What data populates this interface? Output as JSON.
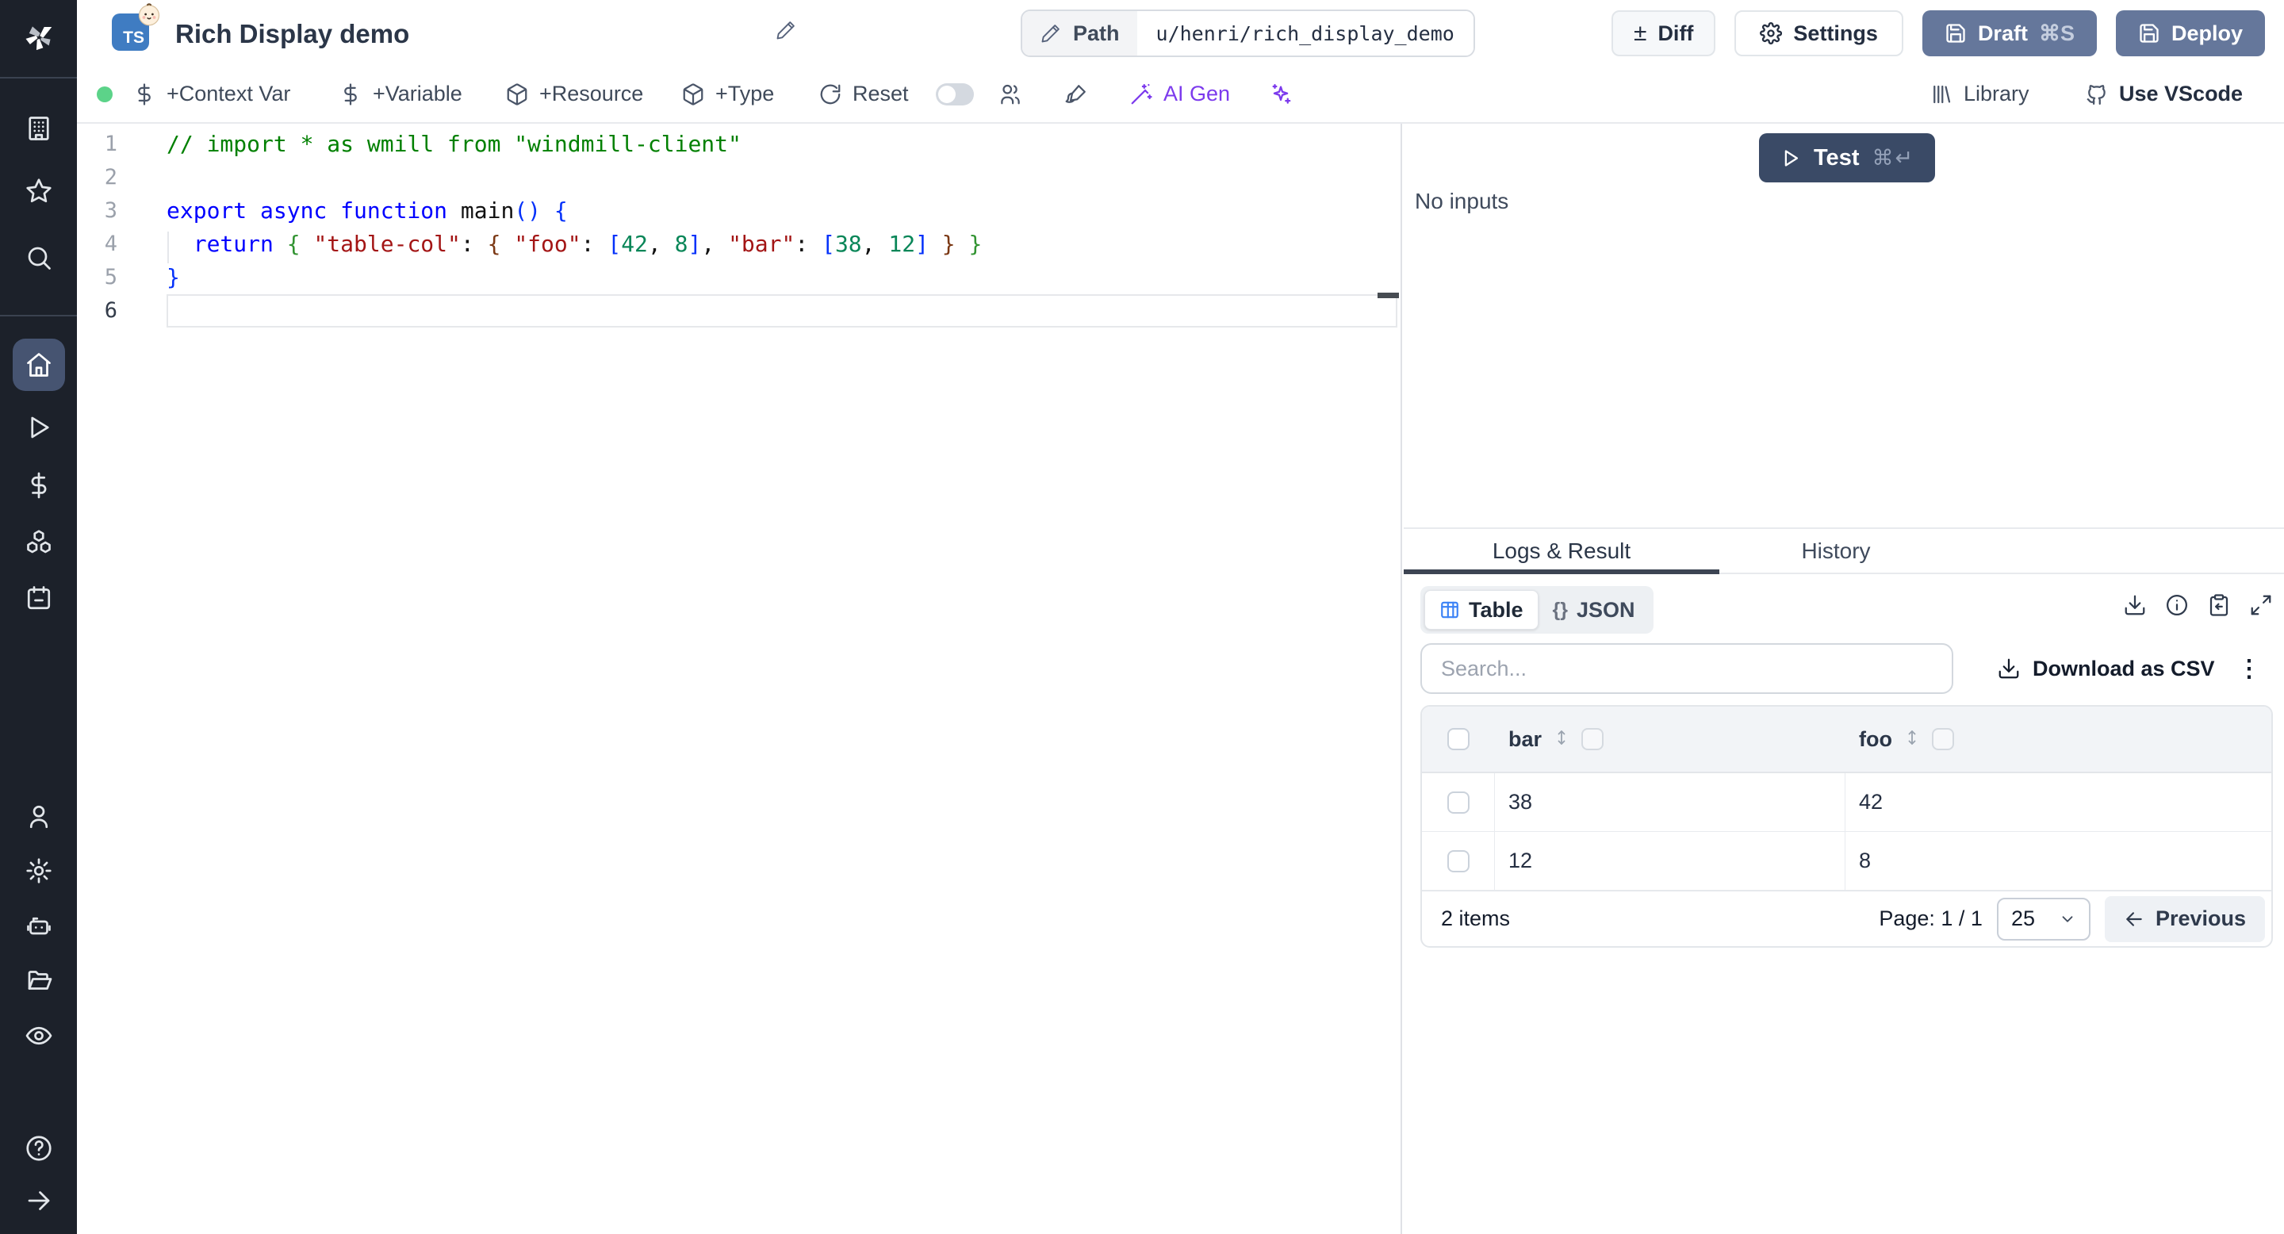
{
  "colors": {
    "sidebar_bg": "#1c212a",
    "sidebar_active_pill": "#465471",
    "status_green": "#5cd389",
    "ts_badge_blue": "#3f7cc2",
    "slate_button": "#65779b",
    "test_button": "#3a4a66",
    "ai_purple": "#7c3aed",
    "table_icon_blue": "#3b82f6",
    "code_comment": "#008000",
    "code_keyword": "#0000ff",
    "code_string": "#a31515",
    "code_number": "#098658"
  },
  "sidebar": {
    "icons": [
      "windmill-logo",
      "workspace-building",
      "favorites-star",
      "search",
      "home",
      "runs-play",
      "variables-dollar",
      "resources-boxes",
      "schedules-calendar",
      "user",
      "settings-gear",
      "workers-robot",
      "folders",
      "audit-eye",
      "help-circle",
      "expand-arrow"
    ]
  },
  "header": {
    "language_badge": "TS",
    "title": "Rich Display demo",
    "path_label": "Path",
    "path_value": "u/henri/rich_display_demo",
    "diff": "Diff",
    "diff_glyph": "±",
    "settings": "Settings",
    "draft": "Draft",
    "draft_shortcut": "⌘S",
    "deploy": "Deploy"
  },
  "toolbar": {
    "add_context_var": "+Context Var",
    "add_variable": "+Variable",
    "add_resource": "+Resource",
    "add_type": "+Type",
    "reset": "Reset",
    "ai_gen": "AI Gen",
    "library": "Library",
    "use_vscode": "Use VScode"
  },
  "editor": {
    "lines": [
      {
        "num": "1",
        "tokens": [
          {
            "t": "// import * as wmill from \"windmill-client\""
          }
        ]
      },
      {
        "num": "2",
        "tokens": []
      },
      {
        "num": "3",
        "tokens": [
          {
            "t": "export async function "
          },
          {
            "t": "main"
          },
          {
            "t": "() {"
          }
        ]
      },
      {
        "num": "4",
        "tokens": [
          {
            "t": "  return "
          },
          {
            "t": "{ "
          },
          {
            "t": "\"table-col\""
          },
          {
            "t": ": "
          },
          {
            "t": "{ "
          },
          {
            "t": "\"foo\""
          },
          {
            "t": ": "
          },
          {
            "t": "["
          },
          {
            "t": "42"
          },
          {
            "t": ", "
          },
          {
            "t": "8"
          },
          {
            "t": "]"
          },
          {
            "t": ", "
          },
          {
            "t": "\"bar\""
          },
          {
            "t": ": "
          },
          {
            "t": "["
          },
          {
            "t": "38"
          },
          {
            "t": ", "
          },
          {
            "t": "12"
          },
          {
            "t": "]"
          },
          {
            "t": " } "
          },
          {
            "t": "}"
          }
        ]
      },
      {
        "num": "5",
        "tokens": [
          {
            "t": "}"
          }
        ]
      },
      {
        "num": "6",
        "tokens": []
      }
    ]
  },
  "run_panel": {
    "test": "Test",
    "test_shortcut": "⌘↵",
    "no_inputs": "No inputs"
  },
  "result_panel": {
    "tab_logs": "Logs & Result",
    "tab_history": "History",
    "view_table": "Table",
    "view_json": "JSON",
    "json_glyph": "{}",
    "search_placeholder": "Search...",
    "download_csv": "Download as CSV",
    "kebab_glyph": "⋮",
    "table": {
      "columns": [
        "bar",
        "foo"
      ],
      "rows": [
        [
          "38",
          "42"
        ],
        [
          "12",
          "8"
        ]
      ]
    },
    "footer": {
      "count": "2 items",
      "page": "Page: 1 / 1",
      "page_size": "25",
      "previous": "Previous"
    }
  }
}
